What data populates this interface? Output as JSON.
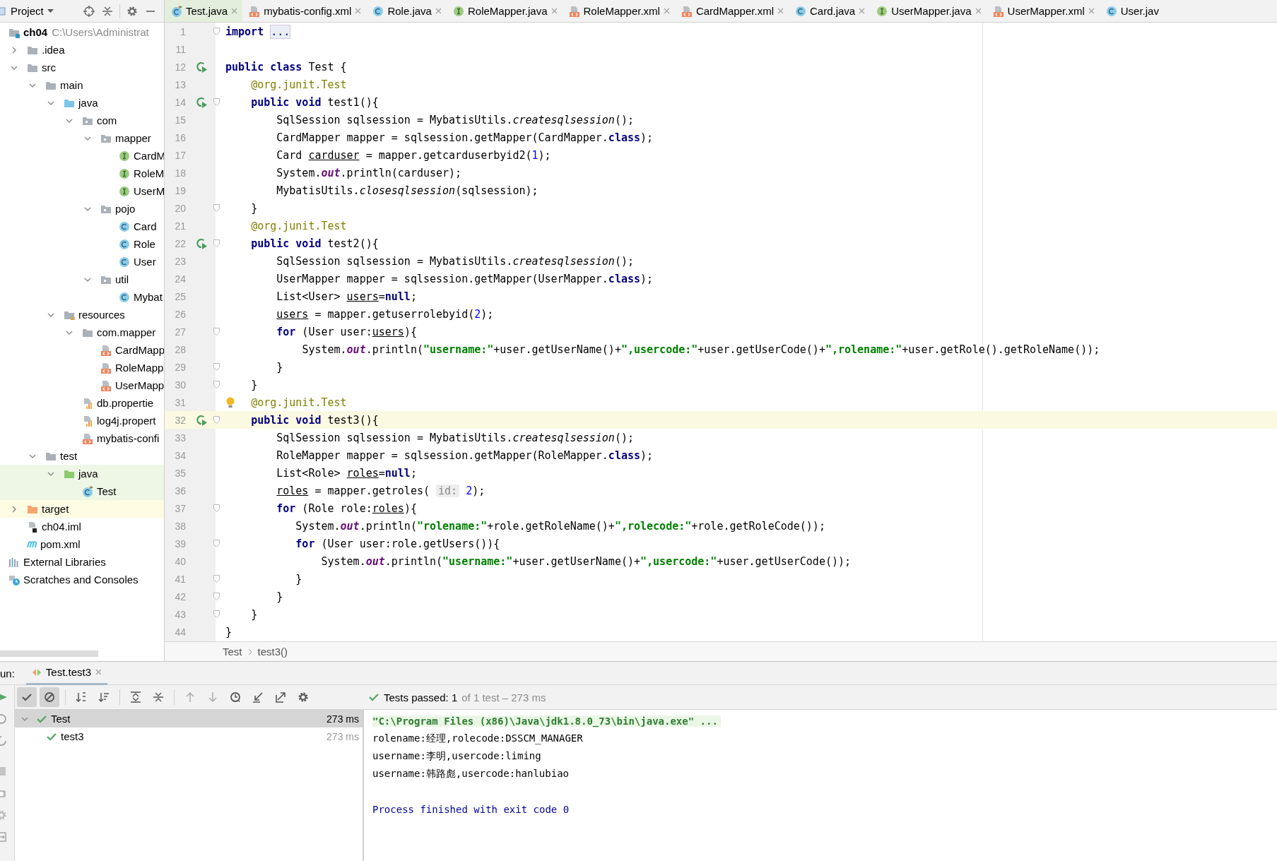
{
  "project_view": {
    "title": "Project"
  },
  "editor_tabs": [
    {
      "label": "Test.java",
      "kind": "class_test",
      "selected": true
    },
    {
      "label": "mybatis-config.xml",
      "kind": "xml",
      "selected": false
    },
    {
      "label": "Role.java",
      "kind": "class",
      "selected": false
    },
    {
      "label": "RoleMapper.java",
      "kind": "interface",
      "selected": false
    },
    {
      "label": "RoleMapper.xml",
      "kind": "xml",
      "selected": false
    },
    {
      "label": "CardMapper.xml",
      "kind": "xml",
      "selected": false
    },
    {
      "label": "Card.java",
      "kind": "class",
      "selected": false
    },
    {
      "label": "UserMapper.java",
      "kind": "interface",
      "selected": false
    },
    {
      "label": "UserMapper.xml",
      "kind": "xml",
      "selected": false
    },
    {
      "label": "User.jav",
      "kind": "class",
      "selected": false
    }
  ],
  "project_tree": [
    {
      "label": "ch04",
      "path": "C:\\Users\\Administrat",
      "kind": "module",
      "children": [
        {
          "label": ".idea",
          "kind": "folder",
          "expanded": false
        },
        {
          "label": "src",
          "kind": "folder",
          "expanded": true,
          "children": [
            {
              "label": "main",
              "kind": "folder",
              "expanded": true,
              "children": [
                {
                  "label": "java",
                  "kind": "source",
                  "expanded": true,
                  "children": [
                    {
                      "label": "com",
                      "kind": "package",
                      "expanded": true,
                      "children": [
                        {
                          "label": "mapper",
                          "kind": "package",
                          "expanded": true,
                          "children": [
                            {
                              "label": "CardM",
                              "kind": "interface"
                            },
                            {
                              "label": "RoleM",
                              "kind": "interface"
                            },
                            {
                              "label": "UserM",
                              "kind": "interface"
                            }
                          ]
                        },
                        {
                          "label": "pojo",
                          "kind": "package",
                          "expanded": true,
                          "children": [
                            {
                              "label": "Card",
                              "kind": "class"
                            },
                            {
                              "label": "Role",
                              "kind": "class"
                            },
                            {
                              "label": "User",
                              "kind": "class"
                            }
                          ]
                        },
                        {
                          "label": "util",
                          "kind": "package",
                          "expanded": true,
                          "children": [
                            {
                              "label": "Mybat",
                              "kind": "class"
                            }
                          ]
                        }
                      ]
                    }
                  ]
                },
                {
                  "label": "resources",
                  "kind": "resources",
                  "expanded": true,
                  "children": [
                    {
                      "label": "com.mapper",
                      "kind": "folder",
                      "expanded": true,
                      "children": [
                        {
                          "label": "CardMapp",
                          "kind": "xml"
                        },
                        {
                          "label": "RoleMapp",
                          "kind": "xml"
                        },
                        {
                          "label": "UserMapp",
                          "kind": "xml"
                        }
                      ]
                    },
                    {
                      "label": "db.propertie",
                      "kind": "properties"
                    },
                    {
                      "label": "log4j.propert",
                      "kind": "properties"
                    },
                    {
                      "label": "mybatis-confi",
                      "kind": "xml"
                    }
                  ]
                }
              ]
            },
            {
              "label": "test",
              "kind": "folder",
              "expanded": true,
              "children": [
                {
                  "label": "java",
                  "kind": "test",
                  "expanded": true,
                  "color": "#eef7e6",
                  "children": [
                    {
                      "label": "Test",
                      "kind": "class_test",
                      "color": "#eef7e6"
                    }
                  ]
                }
              ]
            }
          ]
        },
        {
          "label": "target",
          "kind": "excluded",
          "expanded": false,
          "color": "#fdfbe1"
        },
        {
          "label": "ch04.iml",
          "kind": "iml"
        },
        {
          "label": "pom.xml",
          "kind": "maven"
        }
      ]
    },
    {
      "label": "External Libraries",
      "kind": "libraries"
    },
    {
      "label": "Scratches and Consoles",
      "kind": "scratches"
    }
  ],
  "code_lines": [
    {
      "number": "1",
      "current": false,
      "fold": true,
      "run": false,
      "bulb": false,
      "segments": [
        {
          "kind": "kw",
          "text": "import "
        },
        {
          "kind": "fold",
          "text": "..."
        }
      ]
    },
    {
      "number": "11",
      "current": false,
      "fold": false,
      "run": false,
      "bulb": false
    },
    {
      "number": "12",
      "current": false,
      "fold": false,
      "run": true,
      "bulb": false,
      "segments": [
        {
          "kind": "kw",
          "text": "public class"
        },
        {
          "kind": "plain",
          "text": " Test {"
        }
      ]
    },
    {
      "number": "13",
      "current": false,
      "fold": false,
      "run": false,
      "bulb": false,
      "segments": [
        {
          "kind": "ann",
          "text": "    @org.junit.Test"
        }
      ]
    },
    {
      "number": "14",
      "current": false,
      "fold": true,
      "run": true,
      "bulb": false,
      "segments": [
        {
          "kind": "kw",
          "text": "    public void"
        },
        {
          "kind": "plain",
          "text": " test1(){"
        }
      ]
    },
    {
      "number": "15",
      "current": false,
      "fold": false,
      "run": false,
      "bulb": false,
      "segments": [
        {
          "kind": "plain",
          "text": "        SqlSession sqlsession = MybatisUtils."
        },
        {
          "kind": "ital",
          "text": "createsqlsession"
        },
        {
          "kind": "plain",
          "text": "();"
        }
      ]
    },
    {
      "number": "16",
      "current": false,
      "fold": false,
      "run": false,
      "bulb": false,
      "segments": [
        {
          "kind": "plain",
          "text": "        CardMapper mapper = sqlsession.getMapper(CardMapper."
        },
        {
          "kind": "kw",
          "text": "class"
        },
        {
          "kind": "plain",
          "text": ");"
        }
      ]
    },
    {
      "number": "17",
      "current": false,
      "fold": false,
      "run": false,
      "bulb": false,
      "segments": [
        {
          "kind": "plain",
          "text": "        Card "
        },
        {
          "kind": "var",
          "text": "carduser"
        },
        {
          "kind": "plain",
          "text": " = mapper.getcarduserbyid2("
        },
        {
          "kind": "num",
          "text": "1"
        },
        {
          "kind": "plain",
          "text": ");"
        }
      ]
    },
    {
      "number": "18",
      "current": false,
      "fold": false,
      "run": false,
      "bulb": false,
      "segments": [
        {
          "kind": "plain",
          "text": "        System."
        },
        {
          "kind": "field",
          "text": "out"
        },
        {
          "kind": "plain",
          "text": ".println(carduser);"
        }
      ]
    },
    {
      "number": "19",
      "current": false,
      "fold": false,
      "run": false,
      "bulb": false,
      "segments": [
        {
          "kind": "plain",
          "text": "        MybatisUtils."
        },
        {
          "kind": "ital",
          "text": "closesqlsession"
        },
        {
          "kind": "plain",
          "text": "(sqlsession);"
        }
      ]
    },
    {
      "number": "20",
      "current": false,
      "fold": true,
      "run": false,
      "bulb": false,
      "segments": [
        {
          "kind": "plain",
          "text": "    }"
        }
      ]
    },
    {
      "number": "21",
      "current": false,
      "fold": false,
      "run": false,
      "bulb": false,
      "segments": [
        {
          "kind": "ann",
          "text": "    @org.junit.Test"
        }
      ]
    },
    {
      "number": "22",
      "current": false,
      "fold": true,
      "run": true,
      "bulb": false,
      "segments": [
        {
          "kind": "kw",
          "text": "    public void"
        },
        {
          "kind": "plain",
          "text": " test2(){"
        }
      ]
    },
    {
      "number": "23",
      "current": false,
      "fold": false,
      "run": false,
      "bulb": false,
      "segments": [
        {
          "kind": "plain",
          "text": "        SqlSession sqlsession = MybatisUtils."
        },
        {
          "kind": "ital",
          "text": "createsqlsession"
        },
        {
          "kind": "plain",
          "text": "();"
        }
      ]
    },
    {
      "number": "24",
      "current": false,
      "fold": false,
      "run": false,
      "bulb": false,
      "segments": [
        {
          "kind": "plain",
          "text": "        UserMapper mapper = sqlsession.getMapper(UserMapper."
        },
        {
          "kind": "kw",
          "text": "class"
        },
        {
          "kind": "plain",
          "text": ");"
        }
      ]
    },
    {
      "number": "25",
      "current": false,
      "fold": false,
      "run": false,
      "bulb": false,
      "segments": [
        {
          "kind": "plain",
          "text": "        List<User> "
        },
        {
          "kind": "var",
          "text": "users"
        },
        {
          "kind": "plain",
          "text": "="
        },
        {
          "kind": "kw",
          "text": "null"
        },
        {
          "kind": "plain",
          "text": ";"
        }
      ]
    },
    {
      "number": "26",
      "current": false,
      "fold": false,
      "run": false,
      "bulb": false,
      "segments": [
        {
          "kind": "var",
          "text": "        users"
        },
        {
          "kind": "plain",
          "text": " = mapper.getuserrolebyid("
        },
        {
          "kind": "num",
          "text": "2"
        },
        {
          "kind": "plain",
          "text": ");"
        }
      ]
    },
    {
      "number": "27",
      "current": false,
      "fold": true,
      "run": false,
      "bulb": false,
      "segments": [
        {
          "kind": "kw",
          "text": "        for"
        },
        {
          "kind": "plain",
          "text": " (User user:"
        },
        {
          "kind": "var",
          "text": "users"
        },
        {
          "kind": "plain",
          "text": "){"
        }
      ]
    },
    {
      "number": "28",
      "current": false,
      "fold": false,
      "run": false,
      "bulb": false,
      "segments": [
        {
          "kind": "plain",
          "text": "            System."
        },
        {
          "kind": "field",
          "text": "out"
        },
        {
          "kind": "plain",
          "text": ".println("
        },
        {
          "kind": "str",
          "text": "\"username:\""
        },
        {
          "kind": "plain",
          "text": "+user.getUserName()+"
        },
        {
          "kind": "str",
          "text": "\",usercode:\""
        },
        {
          "kind": "plain",
          "text": "+user.getUserCode()+"
        },
        {
          "kind": "str",
          "text": "\",rolename:\""
        },
        {
          "kind": "plain",
          "text": "+user.getRole().getRoleName());"
        }
      ]
    },
    {
      "number": "29",
      "current": false,
      "fold": true,
      "run": false,
      "bulb": false,
      "segments": [
        {
          "kind": "plain",
          "text": "        }"
        }
      ]
    },
    {
      "number": "30",
      "current": false,
      "fold": true,
      "run": false,
      "bulb": false,
      "segments": [
        {
          "kind": "plain",
          "text": "    }"
        }
      ]
    },
    {
      "number": "31",
      "current": false,
      "fold": false,
      "run": false,
      "bulb": true,
      "segments": [
        {
          "kind": "ann",
          "text": "    @org.junit.Test"
        }
      ]
    },
    {
      "number": "32",
      "current": true,
      "fold": true,
      "run": true,
      "bulb": false,
      "segments": [
        {
          "kind": "kw",
          "text": "    public void"
        },
        {
          "kind": "plain",
          "text": " test3(){"
        }
      ]
    },
    {
      "number": "33",
      "current": false,
      "fold": false,
      "run": false,
      "bulb": false,
      "segments": [
        {
          "kind": "plain",
          "text": "        SqlSession sqlsession = MybatisUtils."
        },
        {
          "kind": "ital",
          "text": "createsqlsession"
        },
        {
          "kind": "plain",
          "text": "();"
        }
      ]
    },
    {
      "number": "34",
      "current": false,
      "fold": false,
      "run": false,
      "bulb": false,
      "segments": [
        {
          "kind": "plain",
          "text": "        RoleMapper mapper = sqlsession.getMapper(RoleMapper."
        },
        {
          "kind": "kw",
          "text": "class"
        },
        {
          "kind": "plain",
          "text": ");"
        }
      ]
    },
    {
      "number": "35",
      "current": false,
      "fold": false,
      "run": false,
      "bulb": false,
      "segments": [
        {
          "kind": "plain",
          "text": "        List<Role> "
        },
        {
          "kind": "var",
          "text": "roles"
        },
        {
          "kind": "plain",
          "text": "="
        },
        {
          "kind": "kw",
          "text": "null"
        },
        {
          "kind": "plain",
          "text": ";"
        }
      ]
    },
    {
      "number": "36",
      "current": false,
      "fold": false,
      "run": false,
      "bulb": false,
      "segments": [
        {
          "kind": "var",
          "text": "        roles"
        },
        {
          "kind": "plain",
          "text": " = mapper.getroles( "
        },
        {
          "kind": "hint",
          "text": "id:"
        },
        {
          "kind": "num",
          "text": " 2"
        },
        {
          "kind": "plain",
          "text": ");"
        }
      ]
    },
    {
      "number": "37",
      "current": false,
      "fold": true,
      "run": false,
      "bulb": false,
      "segments": [
        {
          "kind": "kw",
          "text": "        for"
        },
        {
          "kind": "plain",
          "text": " (Role role:"
        },
        {
          "kind": "var",
          "text": "roles"
        },
        {
          "kind": "plain",
          "text": "){"
        }
      ]
    },
    {
      "number": "38",
      "current": false,
      "fold": false,
      "run": false,
      "bulb": false,
      "segments": [
        {
          "kind": "plain",
          "text": "           System."
        },
        {
          "kind": "field",
          "text": "out"
        },
        {
          "kind": "plain",
          "text": ".println("
        },
        {
          "kind": "str",
          "text": "\"rolename:\""
        },
        {
          "kind": "plain",
          "text": "+role.getRoleName()+"
        },
        {
          "kind": "str",
          "text": "\",rolecode:\""
        },
        {
          "kind": "plain",
          "text": "+role.getRoleCode());"
        }
      ]
    },
    {
      "number": "39",
      "current": false,
      "fold": true,
      "run": false,
      "bulb": false,
      "segments": [
        {
          "kind": "kw",
          "text": "           for"
        },
        {
          "kind": "plain",
          "text": " (User user:role.getUsers()){"
        }
      ]
    },
    {
      "number": "40",
      "current": false,
      "fold": false,
      "run": false,
      "bulb": false,
      "segments": [
        {
          "kind": "plain",
          "text": "               System."
        },
        {
          "kind": "field",
          "text": "out"
        },
        {
          "kind": "plain",
          "text": ".println("
        },
        {
          "kind": "str",
          "text": "\"username:\""
        },
        {
          "kind": "plain",
          "text": "+user.getUserName()+"
        },
        {
          "kind": "str",
          "text": "\",usercode:\""
        },
        {
          "kind": "plain",
          "text": "+user.getUserCode());"
        }
      ]
    },
    {
      "number": "41",
      "current": false,
      "fold": true,
      "run": false,
      "bulb": false,
      "segments": [
        {
          "kind": "plain",
          "text": "           }"
        }
      ]
    },
    {
      "number": "42",
      "current": false,
      "fold": true,
      "run": false,
      "bulb": false,
      "segments": [
        {
          "kind": "plain",
          "text": "        }"
        }
      ]
    },
    {
      "number": "43",
      "current": false,
      "fold": true,
      "run": false,
      "bulb": false,
      "segments": [
        {
          "kind": "plain",
          "text": "    }"
        }
      ]
    },
    {
      "number": "44",
      "current": false,
      "fold": false,
      "run": false,
      "bulb": false,
      "segments": [
        {
          "kind": "plain",
          "text": "}"
        }
      ]
    }
  ],
  "breadcrumbs": [
    "Test",
    "test3()"
  ],
  "run_panel": {
    "label": "un:",
    "tabs": [
      {
        "label": "Test.test3",
        "selected": true
      }
    ]
  },
  "run_toolbar": [
    {
      "kind": "show_passed",
      "pressed": true,
      "disabled": false
    },
    {
      "kind": "show_ignored",
      "pressed": true,
      "disabled": false
    },
    {
      "kind": "separator"
    },
    {
      "kind": "sort_alpha",
      "pressed": false,
      "disabled": false
    },
    {
      "kind": "sort_duration",
      "pressed": false,
      "disabled": false
    },
    {
      "kind": "separator"
    },
    {
      "kind": "expand_all",
      "pressed": false,
      "disabled": false
    },
    {
      "kind": "collapse_all",
      "pressed": false,
      "disabled": false
    },
    {
      "kind": "separator"
    },
    {
      "kind": "previous",
      "pressed": false,
      "disabled": true
    },
    {
      "kind": "next",
      "pressed": false,
      "disabled": true
    },
    {
      "kind": "history",
      "pressed": false,
      "disabled": false
    },
    {
      "kind": "import",
      "pressed": false,
      "disabled": false
    },
    {
      "kind": "export",
      "pressed": false,
      "disabled": false
    },
    {
      "kind": "settings",
      "pressed": false,
      "disabled": false
    }
  ],
  "test_status": {
    "passed": true,
    "summary": "Tests passed: 1",
    "detail": "of 1 test – 273 ms"
  },
  "test_results": [
    {
      "name": "Test",
      "time": "273 ms",
      "passed": true,
      "selected": true,
      "expanded": true,
      "children": [
        {
          "name": "test3",
          "time": "273 ms",
          "passed": true,
          "selected": false
        }
      ]
    }
  ],
  "console": [
    {
      "kind": "command",
      "text": "\"C:\\Program Files (x86)\\Java\\jdk1.8.0_73\\bin\\java.exe\" ..."
    },
    {
      "kind": "output",
      "text": "rolename:经理,rolecode:DSSCM_MANAGER"
    },
    {
      "kind": "output",
      "text": "username:李明,usercode:liming"
    },
    {
      "kind": "output",
      "text": "username:韩路彪,usercode:hanlubiao"
    },
    {
      "kind": "exit",
      "text": "Process finished with exit code 0"
    }
  ]
}
